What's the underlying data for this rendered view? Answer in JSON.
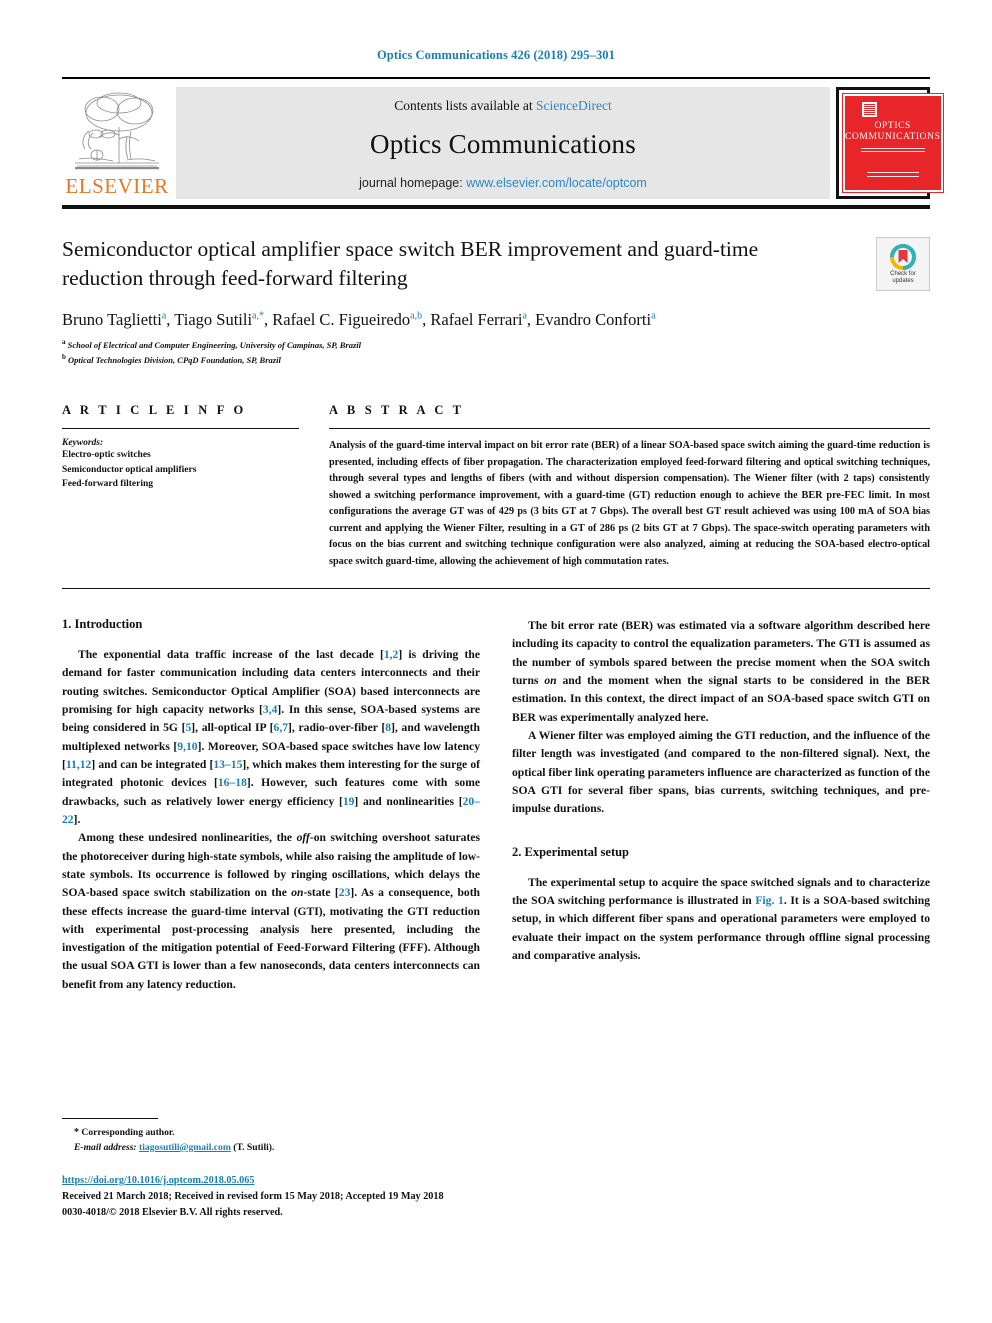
{
  "running_head": "Optics Communications 426 (2018) 295–301",
  "masthead": {
    "contents_prefix": "Contents lists available at ",
    "contents_link": "ScienceDirect",
    "journal_name": "Optics Communications",
    "homepage_prefix": "journal homepage: ",
    "homepage_link": "www.elsevier.com/locate/optcom",
    "publisher_wordmark": "ELSEVIER",
    "cover_title_line1": "Optics",
    "cover_title_line2": "Communications"
  },
  "article": {
    "title": "Semiconductor optical amplifier space switch BER improvement and guard-time reduction through feed-forward filtering",
    "crossmark_label_line1": "Check for",
    "crossmark_label_line2": "updates",
    "authors": [
      {
        "name": "Bruno Taglietti",
        "marks": "a"
      },
      {
        "name": "Tiago Sutili",
        "marks": "a,*"
      },
      {
        "name": "Rafael C. Figueiredo",
        "marks": "a,b"
      },
      {
        "name": "Rafael Ferrari",
        "marks": "a"
      },
      {
        "name": "Evandro Conforti",
        "marks": "a"
      }
    ],
    "affiliations": [
      {
        "mark": "a",
        "text": "School of Electrical and Computer Engineering, University of Campinas, SP, Brazil"
      },
      {
        "mark": "b",
        "text": "Optical Technologies Division, CPqD Foundation, SP, Brazil"
      }
    ]
  },
  "article_info": {
    "heading": "A R T I C L E   I N F O",
    "keywords_label": "Keywords:",
    "keywords": [
      "Electro-optic switches",
      "Semiconductor optical amplifiers",
      "Feed-forward filtering"
    ]
  },
  "abstract": {
    "heading": "A B S T R A C T",
    "text": "Analysis of the guard-time interval impact on bit error rate (BER) of a linear SOA-based space switch aiming the guard-time reduction is presented, including effects of fiber propagation. The characterization employed feed-forward filtering and optical switching techniques, through several types and lengths of fibers (with and without dispersion compensation). The Wiener filter (with 2 taps) consistently showed a switching performance improvement, with a guard-time (GT) reduction enough to achieve the BER pre-FEC limit. In most configurations the average GT was of 429 ps (3 bits GT at 7 Gbps). The overall best GT result achieved was using 100 mA of SOA bias current and applying the Wiener Filter, resulting in a GT of 286 ps (2 bits GT at 7 Gbps). The space-switch operating parameters with focus on the bias current and switching technique configuration were also analyzed, aiming at reducing the SOA-based electro-optical space switch guard-time, allowing the achievement of high commutation rates."
  },
  "sections": {
    "introduction_heading": "1.  Introduction",
    "experimental_heading": "2.  Experimental setup"
  },
  "paragraphs": {
    "intro_p1": "The exponential data traffic increase of the last decade [1,2] is driving the demand for faster communication including data centers interconnects and their routing switches. Semiconductor Optical Amplifier (SOA) based interconnects are promising for high capacity networks [3,4]. In this sense, SOA-based systems are being considered in 5G [5], all-optical IP [6,7], radio-over-fiber [8], and wavelength multiplexed networks [9,10]. Moreover, SOA-based space switches have low latency [11,12] and can be integrated [13–15], which makes them interesting for the surge of integrated photonic devices [16–18]. However, such features come with some drawbacks, such as relatively lower energy efficiency [19] and nonlinearities [20–22].",
    "intro_p2": "Among these undesired nonlinearities, the off-on switching overshoot saturates the photoreceiver during high-state symbols, while also raising the amplitude of low-state symbols. Its occurrence is followed by ringing oscillations, which delays the SOA-based space switch stabilization on the on-state [23]. As a consequence, both these effects increase the guard-time interval (GTI), motivating the GTI reduction with experimental post-processing analysis here presented, including the investigation of the mitigation potential of Feed-Forward Filtering (FFF). Although the usual SOA GTI is lower than a few nanoseconds, data centers interconnects can benefit from any latency reduction.",
    "right_p1": "The bit error rate (BER) was estimated via a software algorithm described here including its capacity to control the equalization parameters. The GTI is assumed as the number of symbols spared between the precise moment when the SOA switch turns on and the moment when the signal starts to be considered in the BER estimation. In this context, the direct impact of an SOA-based space switch GTI on BER was experimentally analyzed here.",
    "right_p2": "A Wiener filter was employed aiming the GTI reduction, and the influence of the filter length was investigated (and compared to the non-filtered signal). Next, the optical fiber link operating parameters influence are characterized as function of the SOA GTI for several fiber spans, bias currents, switching techniques, and pre-impulse durations.",
    "right_p3": "The experimental setup to acquire the space switched signals and to characterize the SOA switching performance is illustrated in Fig. 1. It is a SOA-based switching  setup, in which different fiber spans and operational parameters were employed to evaluate their impact on the system performance through offline signal processing and comparative analysis."
  },
  "footer": {
    "corresponding_star": "*",
    "corresponding_text": "Corresponding author.",
    "email_label": "E-mail address:",
    "email": "tiagosutili@gmail.com",
    "email_suffix": "(T. Sutili).",
    "doi": "https://doi.org/10.1016/j.optcom.2018.05.065",
    "dates": "Received 21 March 2018; Received in revised form 15 May 2018; Accepted 19 May 2018",
    "copyright": "0030-4018/© 2018 Elsevier B.V. All rights reserved."
  },
  "colors": {
    "link_blue": "#1a7eb5",
    "banner_link": "#2f86c5",
    "elsevier_orange": "#e87722",
    "cover_red": "#e8262a",
    "banner_gray": "#e6e6e6"
  }
}
